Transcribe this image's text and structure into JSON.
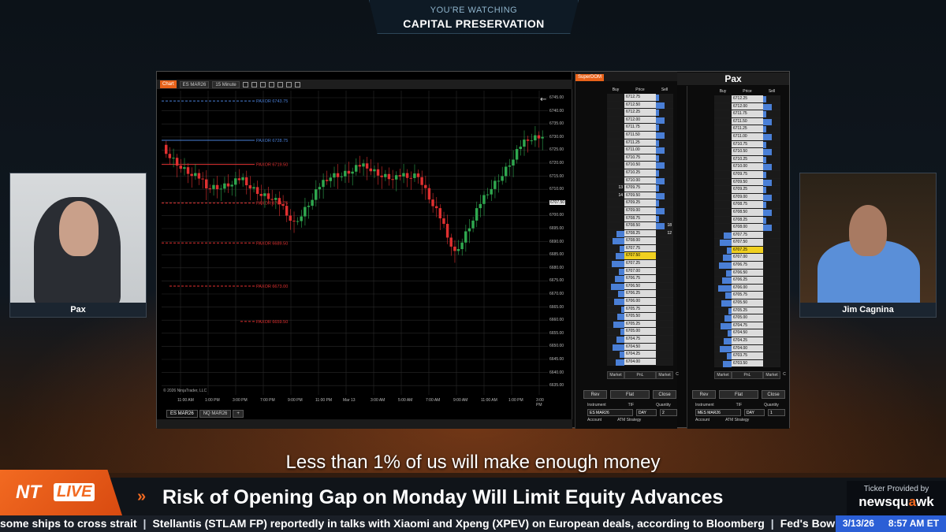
{
  "banner": {
    "top": "YOU'RE WATCHING",
    "show": "CAPITAL PRESERVATION"
  },
  "webcams": {
    "left_name": "Pax",
    "right_name": "Jim Cagnina"
  },
  "chart": {
    "tab": "Chart",
    "instrument": "ES MAR26",
    "interval": "15 Minute",
    "copyright": "© 2026 NinjaTrader, LLC",
    "price_labels": [
      "6745.00",
      "6740.00",
      "6735.00",
      "6730.00",
      "6725.00",
      "6720.00",
      "6715.00",
      "6710.00",
      "6707.50",
      "6700.00",
      "6695.00",
      "6690.00",
      "6685.00",
      "6680.00",
      "6675.00",
      "6670.00",
      "6665.00",
      "6660.00",
      "6655.00",
      "6650.00",
      "6645.00",
      "6640.00",
      "6635.00"
    ],
    "time_labels": [
      "11:00 AM",
      "1:00 PM",
      "3:00 PM",
      "7:00 PM",
      "9:00 PM",
      "11:00 PM",
      "Mar 13",
      "3:00 AM",
      "5:00 AM",
      "7:00 AM",
      "9:00 AM",
      "11:00 AM",
      "1:00 PM",
      "3:00 PM"
    ],
    "levels": [
      {
        "label": "PAXOR 6743.75",
        "color": "#4a7fd6"
      },
      {
        "label": "PAXOR 6728.75",
        "color": "#4a7fd6"
      },
      {
        "label": "PAXOR 6719.50",
        "color": "#e03030"
      },
      {
        "label": "PAXOR 6704.75",
        "color": "#e03030"
      },
      {
        "label": "PAXOR 6689.50",
        "color": "#e03030"
      },
      {
        "label": "PAXOR 6673.00",
        "color": "#e03030"
      },
      {
        "label": "PAXOR 6659.50",
        "color": "#e03030"
      }
    ],
    "instrument_tabs": [
      "ES MAR26",
      "NQ MAR26",
      "+"
    ]
  },
  "dom1": {
    "tag": "SuperDOM",
    "headers": [
      "Buy",
      "Price",
      "Sell"
    ],
    "prices": [
      "6712.75",
      "6712.50",
      "6712.25",
      "6712.00",
      "6711.75",
      "6711.50",
      "6711.25",
      "6711.00",
      "6710.75",
      "6710.50",
      "6710.25",
      "6710.00",
      "6709.75",
      "6709.50",
      "6709.25",
      "6709.00",
      "6708.75",
      "6708.50",
      "6708.25",
      "6708.00",
      "6707.75",
      "6707.50",
      "6707.25",
      "6707.00",
      "6706.75",
      "6706.50",
      "6706.25",
      "6706.00",
      "6705.75",
      "6705.50",
      "6705.25",
      "6705.00",
      "6704.75",
      "6704.50",
      "6704.25",
      "6704.00"
    ],
    "sell_sizes": [
      "",
      "",
      "",
      "",
      "",
      "",
      "",
      "",
      "",
      "",
      "",
      "",
      "",
      "",
      "",
      "",
      "",
      "18",
      "12",
      "",
      "",
      "",
      "",
      "",
      "",
      "",
      "",
      "",
      "",
      "",
      "",
      "",
      "",
      "",
      "",
      ""
    ],
    "buy_sizes": [
      "",
      "",
      "",
      "",
      "",
      "",
      "",
      "",
      "",
      "",
      "",
      "",
      "13",
      "14",
      "",
      "",
      "",
      "",
      "",
      "",
      "",
      "",
      "",
      "",
      "",
      "",
      "",
      "",
      "",
      "",
      "",
      "",
      "",
      "",
      "",
      ""
    ],
    "market_row": [
      "Market",
      "PnL",
      "Market",
      "C"
    ],
    "buttons": [
      "Rev",
      "Flat",
      "Close"
    ],
    "field_labels": [
      "Instrument",
      "TIF",
      "Quantity"
    ],
    "instrument": "ES MAR26",
    "tif": "DAY",
    "quantity": "2",
    "account_label": "Account",
    "atm_label": "ATM Strategy"
  },
  "dom2": {
    "title": "Pax",
    "headers": [
      "Buy",
      "Price",
      "Sell"
    ],
    "prices": [
      "6712.25",
      "6712.00",
      "6711.75",
      "6711.50",
      "6711.25",
      "6711.00",
      "6710.75",
      "6710.50",
      "6710.25",
      "6710.00",
      "6709.75",
      "6709.50",
      "6709.25",
      "6709.00",
      "6708.75",
      "6708.50",
      "6708.25",
      "6708.00",
      "6707.75",
      "6707.50",
      "6707.25",
      "6707.00",
      "6706.75",
      "6706.50",
      "6706.25",
      "6706.00",
      "6705.75",
      "6705.50",
      "6705.25",
      "6705.00",
      "6704.75",
      "6704.50",
      "6704.25",
      "6704.00",
      "6703.75",
      "6703.50"
    ],
    "market_row": [
      "Market",
      "PnL",
      "Market",
      "C"
    ],
    "buttons": [
      "Rev",
      "Flat",
      "Close"
    ],
    "field_labels": [
      "Instrument",
      "TIF",
      "Quantity"
    ],
    "instrument": "MES MAR26",
    "tif": "DAY",
    "quantity": "1",
    "account_label": "Account",
    "atm_label": "ATM Strategy"
  },
  "caption": "Less than 1% of us will make enough money",
  "live_logo": {
    "nt": "NT",
    "live": "LIVE"
  },
  "headline": "Risk of Opening Gap on Monday Will Limit Equity Advances",
  "provider": {
    "line1": "Ticker Provided by",
    "brand_a": "newsqu",
    "brand_q": "a",
    "brand_b": "wk"
  },
  "ticker": [
    "some ships to cross strait",
    "Stellantis (STLAM FP) reportedly in talks with Xiaomi and Xpeng (XPEV) on European deals, according to Bloomberg",
    "Fed's Bowman (vo"
  ],
  "clock": {
    "date": "3/13/26",
    "time": "8:57 AM ET"
  },
  "colors": {
    "accent": "#f26a21",
    "up": "#2fa84f",
    "down": "#e03030"
  }
}
